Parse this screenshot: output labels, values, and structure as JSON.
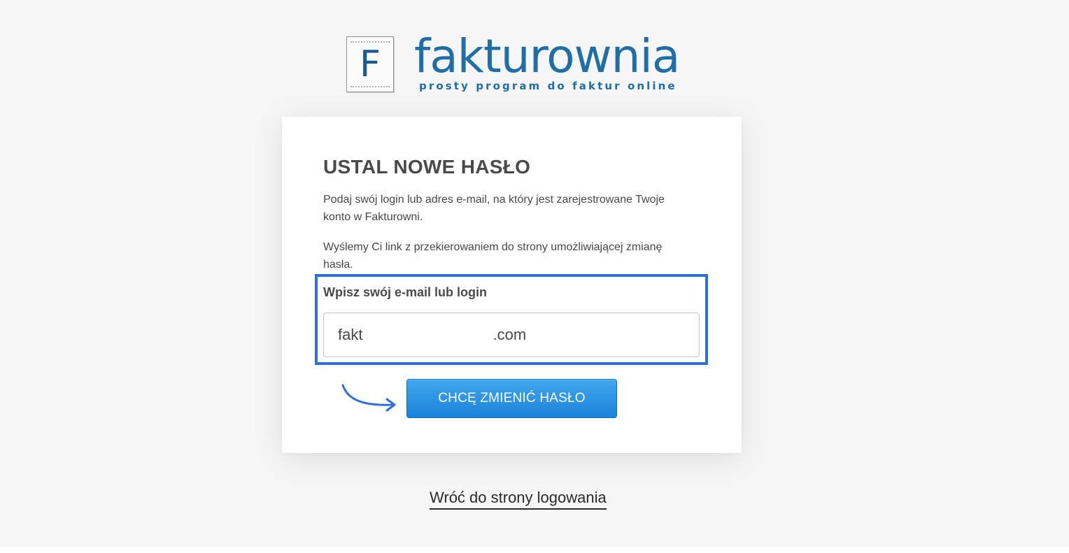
{
  "colors": {
    "brand": "#1e6eaa",
    "highlight": "#2f6fd8",
    "button": "#1a82d8",
    "background": "#f6f6f6"
  },
  "logo": {
    "letter": "F",
    "name": "fakturownia",
    "tagline": "prosty program do faktur online"
  },
  "form": {
    "title": "USTAL NOWE HASŁO",
    "description_1": "Podaj swój login lub adres e-mail, na który jest zarejestrowane Twoje konto w Fakturowni.",
    "description_2": "Wyślemy Ci link z przekierowaniem do strony umożliwiającej zmianę hasła.",
    "field_label": "Wpisz swój e-mail lub login",
    "field_value": "fakt .com",
    "submit_label": "CHCĘ ZMIENIĆ HASŁO",
    "arrow_icon": "curved-arrow-right-icon"
  },
  "footer": {
    "back_link": "Wróć do strony logowania"
  }
}
